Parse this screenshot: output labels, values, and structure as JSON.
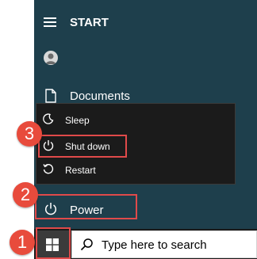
{
  "start_menu": {
    "title": "START",
    "documents_label": "Documents",
    "power_label": "Power"
  },
  "power_flyout": {
    "items": [
      {
        "label": "Sleep",
        "icon": "moon-icon"
      },
      {
        "label": "Shut down",
        "icon": "power-icon"
      },
      {
        "label": "Restart",
        "icon": "restart-icon"
      }
    ]
  },
  "annotations": {
    "step1": "1",
    "step2": "2",
    "step3": "3",
    "highlight_color": "#e04a4a"
  },
  "taskbar": {
    "search_placeholder": "Type here to search"
  },
  "colors": {
    "menu_bg": "#1e3f4c",
    "flyout_bg": "#1b1b1b",
    "badge": "#e84b3c"
  }
}
